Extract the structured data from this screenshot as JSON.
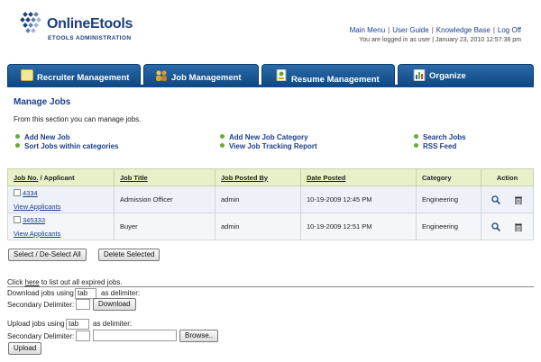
{
  "brand": {
    "name": "OnlineEtools",
    "subtitle": "ETOOLS ADMINISTRATION"
  },
  "top_links": [
    "Main Menu",
    "User Guide",
    "Knowledge Base",
    "Log Off"
  ],
  "logged_info": "You are logged in as user | January 23, 2010 12:57:38 pm",
  "tabs": [
    {
      "label": "Recruiter Management"
    },
    {
      "label": "Job Management"
    },
    {
      "label": "Resume Management"
    },
    {
      "label": "Organize"
    }
  ],
  "page_title": "Manage Jobs",
  "intro": "From this section you can manage jobs.",
  "quick_links": [
    "Add New Job",
    "Sort Jobs within categories",
    "Add New Job Category",
    "View Job Tracking Report",
    "Search Jobs",
    "RSS Feed"
  ],
  "table": {
    "headers": {
      "job_no": "Job No.",
      "job_no_sep": " / Applicant",
      "job_title": "Job Title",
      "posted_by": "Job Posted By",
      "date_posted": "Date Posted",
      "category": "Category",
      "action": "Action"
    },
    "rows": [
      {
        "job_no": "4334",
        "applicants_link": "View Applicants",
        "title": "Admission Officer",
        "posted_by": "admin",
        "date": "10-19-2009 12:45 PM",
        "category": "Engineering"
      },
      {
        "job_no": "345333",
        "applicants_link": "View Applicants",
        "title": "Buyer",
        "posted_by": "admin",
        "date": "10-19-2009 12:51 PM",
        "category": "Engineering"
      }
    ]
  },
  "buttons": {
    "select_all": "Select / De-Select All",
    "delete_selected": "Delete Selected",
    "download": "Download",
    "browse": "Browse..",
    "upload": "Upload"
  },
  "expired": {
    "prefix": "Click ",
    "link": "here",
    "suffix": " to list out all expired jobs."
  },
  "download_section": {
    "label_before": "Download jobs using",
    "delimiter_value": "tab",
    "label_after": "as delimiter:",
    "secondary_label": "Secondary Delimiter:",
    "secondary_value": ""
  },
  "upload_section": {
    "label_before": "Upload jobs using",
    "delimiter_value": "tab",
    "label_after": "as delimiter:",
    "secondary_label": "Secondary Delimiter:",
    "secondary_value": "",
    "file_value": ""
  },
  "colors": {
    "tab_blue": "#0f4a86",
    "link_blue": "#1a3f8f",
    "header_green": "#e8f0c9",
    "bullet_green": "#6aa83a"
  }
}
